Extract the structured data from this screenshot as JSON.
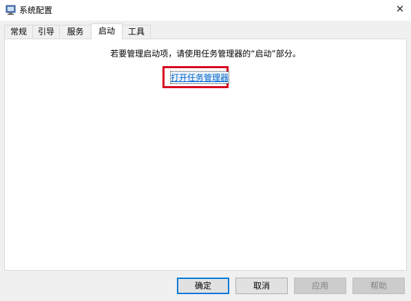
{
  "window": {
    "title": "系统配置",
    "close_glyph": "✕"
  },
  "tabs": [
    {
      "label": "常规"
    },
    {
      "label": "引导"
    },
    {
      "label": "服务"
    },
    {
      "label": "启动",
      "active": true
    },
    {
      "label": "工具"
    }
  ],
  "panel": {
    "message": "若要管理启动项，请使用任务管理器的“启动”部分。",
    "link_label": "打开任务管理器",
    "highlight_color": "#d8001f"
  },
  "buttons": {
    "ok_label": "确定",
    "cancel_label": "取消",
    "apply_label": "应用",
    "help_label": "帮助"
  },
  "colors": {
    "accent": "#0078d7",
    "link": "#0066cc"
  }
}
